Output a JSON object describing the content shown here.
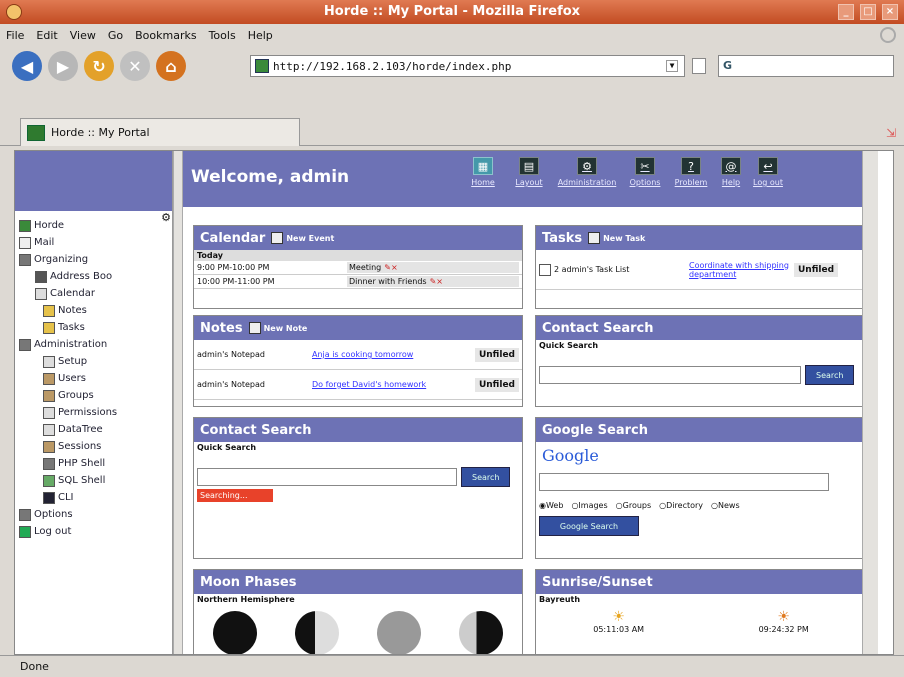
{
  "window": {
    "title": "Horde :: My Portal - Mozilla Firefox"
  },
  "menu": [
    "File",
    "Edit",
    "View",
    "Go",
    "Bookmarks",
    "Tools",
    "Help"
  ],
  "nav": {
    "url": "http://192.168.2.103/horde/index.php"
  },
  "tab": {
    "label": "Horde :: My Portal"
  },
  "sidebar": {
    "items": [
      "Horde",
      "Mail",
      "Organizing",
      "Address Boo",
      "Calendar",
      "Notes",
      "Tasks",
      "Administration",
      "Setup",
      "Users",
      "Groups",
      "Permissions",
      "DataTree",
      "Sessions",
      "PHP Shell",
      "SQL Shell",
      "CLI",
      "Options",
      "Log out"
    ]
  },
  "header": {
    "welcome": "Welcome, admin"
  },
  "toolbar": [
    "Home",
    "Layout",
    "Administration",
    "Options",
    "Problem",
    "Help",
    "Log out"
  ],
  "calendar": {
    "title": "Calendar",
    "link": "New Event",
    "today": "Today",
    "events": [
      {
        "time": "9:00 PM-10:00 PM",
        "title": "Meeting"
      },
      {
        "time": "10:00 PM-11:00 PM",
        "title": "Dinner with Friends"
      }
    ]
  },
  "tasks": {
    "title": "Tasks",
    "link": "New Task",
    "list": "2 admin's Task List",
    "task": "Coordinate with shipping department",
    "tag": "Unfiled"
  },
  "notes": {
    "title": "Notes",
    "link": "New Note",
    "rows": [
      {
        "book": "admin's Notepad",
        "text": "Anja is cooking tomorrow",
        "tag": "Unfiled"
      },
      {
        "book": "admin's Notepad",
        "text": "Do forget David's homework",
        "tag": "Unfiled"
      }
    ]
  },
  "contact1": {
    "title": "Contact Search",
    "sub": "Quick Search",
    "button": "Search"
  },
  "contact2": {
    "title": "Contact Search",
    "sub": "Quick Search",
    "button": "Search",
    "status": "Searching..."
  },
  "google": {
    "title": "Google Search",
    "logo": "Google",
    "options": [
      "Web",
      "Images",
      "Groups",
      "Directory",
      "News"
    ],
    "button": "Google Search"
  },
  "moon": {
    "title": "Moon Phases",
    "sub": "Northern Hemisphere"
  },
  "sun": {
    "title": "Sunrise/Sunset",
    "location": "Bayreuth",
    "sunrise": "05:11:03 AM",
    "sunset": "09:24:32 PM"
  },
  "status": "Done"
}
